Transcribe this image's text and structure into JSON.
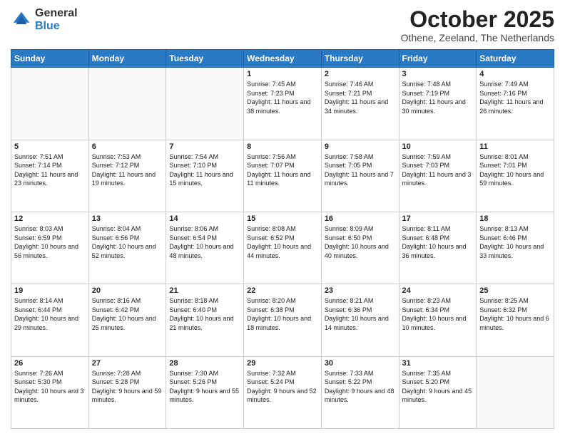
{
  "logo": {
    "general": "General",
    "blue": "Blue"
  },
  "header": {
    "month": "October 2025",
    "location": "Othene, Zeeland, The Netherlands"
  },
  "days_of_week": [
    "Sunday",
    "Monday",
    "Tuesday",
    "Wednesday",
    "Thursday",
    "Friday",
    "Saturday"
  ],
  "weeks": [
    [
      {
        "day": "",
        "info": ""
      },
      {
        "day": "",
        "info": ""
      },
      {
        "day": "",
        "info": ""
      },
      {
        "day": "1",
        "info": "Sunrise: 7:45 AM\nSunset: 7:23 PM\nDaylight: 11 hours\nand 38 minutes."
      },
      {
        "day": "2",
        "info": "Sunrise: 7:46 AM\nSunset: 7:21 PM\nDaylight: 11 hours\nand 34 minutes."
      },
      {
        "day": "3",
        "info": "Sunrise: 7:48 AM\nSunset: 7:19 PM\nDaylight: 11 hours\nand 30 minutes."
      },
      {
        "day": "4",
        "info": "Sunrise: 7:49 AM\nSunset: 7:16 PM\nDaylight: 11 hours\nand 26 minutes."
      }
    ],
    [
      {
        "day": "5",
        "info": "Sunrise: 7:51 AM\nSunset: 7:14 PM\nDaylight: 11 hours\nand 23 minutes."
      },
      {
        "day": "6",
        "info": "Sunrise: 7:53 AM\nSunset: 7:12 PM\nDaylight: 11 hours\nand 19 minutes."
      },
      {
        "day": "7",
        "info": "Sunrise: 7:54 AM\nSunset: 7:10 PM\nDaylight: 11 hours\nand 15 minutes."
      },
      {
        "day": "8",
        "info": "Sunrise: 7:56 AM\nSunset: 7:07 PM\nDaylight: 11 hours\nand 11 minutes."
      },
      {
        "day": "9",
        "info": "Sunrise: 7:58 AM\nSunset: 7:05 PM\nDaylight: 11 hours\nand 7 minutes."
      },
      {
        "day": "10",
        "info": "Sunrise: 7:59 AM\nSunset: 7:03 PM\nDaylight: 11 hours\nand 3 minutes."
      },
      {
        "day": "11",
        "info": "Sunrise: 8:01 AM\nSunset: 7:01 PM\nDaylight: 10 hours\nand 59 minutes."
      }
    ],
    [
      {
        "day": "12",
        "info": "Sunrise: 8:03 AM\nSunset: 6:59 PM\nDaylight: 10 hours\nand 56 minutes."
      },
      {
        "day": "13",
        "info": "Sunrise: 8:04 AM\nSunset: 6:56 PM\nDaylight: 10 hours\nand 52 minutes."
      },
      {
        "day": "14",
        "info": "Sunrise: 8:06 AM\nSunset: 6:54 PM\nDaylight: 10 hours\nand 48 minutes."
      },
      {
        "day": "15",
        "info": "Sunrise: 8:08 AM\nSunset: 6:52 PM\nDaylight: 10 hours\nand 44 minutes."
      },
      {
        "day": "16",
        "info": "Sunrise: 8:09 AM\nSunset: 6:50 PM\nDaylight: 10 hours\nand 40 minutes."
      },
      {
        "day": "17",
        "info": "Sunrise: 8:11 AM\nSunset: 6:48 PM\nDaylight: 10 hours\nand 36 minutes."
      },
      {
        "day": "18",
        "info": "Sunrise: 8:13 AM\nSunset: 6:46 PM\nDaylight: 10 hours\nand 33 minutes."
      }
    ],
    [
      {
        "day": "19",
        "info": "Sunrise: 8:14 AM\nSunset: 6:44 PM\nDaylight: 10 hours\nand 29 minutes."
      },
      {
        "day": "20",
        "info": "Sunrise: 8:16 AM\nSunset: 6:42 PM\nDaylight: 10 hours\nand 25 minutes."
      },
      {
        "day": "21",
        "info": "Sunrise: 8:18 AM\nSunset: 6:40 PM\nDaylight: 10 hours\nand 21 minutes."
      },
      {
        "day": "22",
        "info": "Sunrise: 8:20 AM\nSunset: 6:38 PM\nDaylight: 10 hours\nand 18 minutes."
      },
      {
        "day": "23",
        "info": "Sunrise: 8:21 AM\nSunset: 6:36 PM\nDaylight: 10 hours\nand 14 minutes."
      },
      {
        "day": "24",
        "info": "Sunrise: 8:23 AM\nSunset: 6:34 PM\nDaylight: 10 hours\nand 10 minutes."
      },
      {
        "day": "25",
        "info": "Sunrise: 8:25 AM\nSunset: 6:32 PM\nDaylight: 10 hours\nand 6 minutes."
      }
    ],
    [
      {
        "day": "26",
        "info": "Sunrise: 7:26 AM\nSunset: 5:30 PM\nDaylight: 10 hours\nand 3 minutes."
      },
      {
        "day": "27",
        "info": "Sunrise: 7:28 AM\nSunset: 5:28 PM\nDaylight: 9 hours\nand 59 minutes."
      },
      {
        "day": "28",
        "info": "Sunrise: 7:30 AM\nSunset: 5:26 PM\nDaylight: 9 hours\nand 55 minutes."
      },
      {
        "day": "29",
        "info": "Sunrise: 7:32 AM\nSunset: 5:24 PM\nDaylight: 9 hours\nand 52 minutes."
      },
      {
        "day": "30",
        "info": "Sunrise: 7:33 AM\nSunset: 5:22 PM\nDaylight: 9 hours\nand 48 minutes."
      },
      {
        "day": "31",
        "info": "Sunrise: 7:35 AM\nSunset: 5:20 PM\nDaylight: 9 hours\nand 45 minutes."
      },
      {
        "day": "",
        "info": ""
      }
    ]
  ]
}
